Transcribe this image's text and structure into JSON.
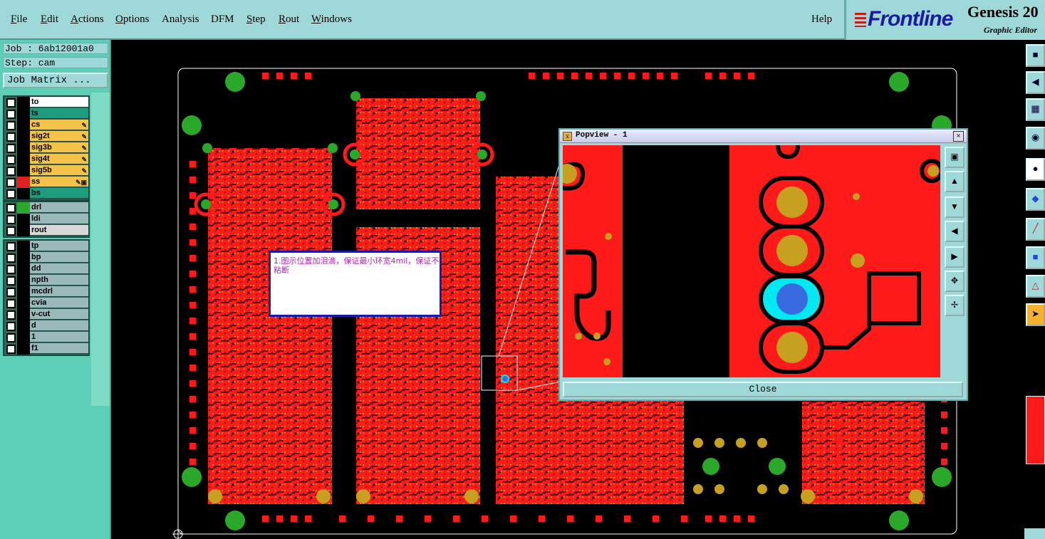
{
  "menu": {
    "file": {
      "u": "F",
      "rest": "ile"
    },
    "edit": {
      "u": "E",
      "rest": "dit"
    },
    "actions": {
      "u": "A",
      "rest": "ctions"
    },
    "options": {
      "u": "O",
      "rest": "ptions"
    },
    "analysis": {
      "u": "",
      "rest": "Analysis"
    },
    "dfm": {
      "u": "",
      "rest": "DFM"
    },
    "step": {
      "u": "S",
      "rest": "tep"
    },
    "rout": {
      "u": "R",
      "rest": "out"
    },
    "windows": {
      "u": "W",
      "rest": "indows"
    },
    "help": {
      "u": "",
      "rest": "Help"
    }
  },
  "brand": {
    "logo_text": "Frontline",
    "product": "Genesis 20",
    "subtitle": "Graphic Editor"
  },
  "job": {
    "job_line": "Job : 6ab12001a0",
    "step_line": "Step: cam",
    "matrix_button": "Job Matrix ..."
  },
  "layers_group1": [
    {
      "name": "to",
      "color": "#ffffff",
      "mid": "#000000",
      "flag": ""
    },
    {
      "name": "ts",
      "color": "#1d9c7e",
      "mid": "#000000",
      "flag": ""
    },
    {
      "name": "cs",
      "color": "#f5c24a",
      "mid": "#000000",
      "flag": "✎"
    },
    {
      "name": "sig2t",
      "color": "#f5c24a",
      "mid": "#000000",
      "flag": "✎"
    },
    {
      "name": "sig3b",
      "color": "#f5c24a",
      "mid": "#000000",
      "flag": "✎"
    },
    {
      "name": "sig4t",
      "color": "#f5c24a",
      "mid": "#000000",
      "flag": "✎"
    },
    {
      "name": "sig5b",
      "color": "#f5c24a",
      "mid": "#000000",
      "flag": "✎"
    },
    {
      "name": "ss",
      "color": "#f5c24a",
      "mid": "#e02020",
      "flag": "✎▣"
    },
    {
      "name": "bs",
      "color": "#1d9c7e",
      "mid": "#000000",
      "flag": ""
    }
  ],
  "layers_group2": [
    {
      "name": "drl",
      "color": "#9bb8bb",
      "mid": "#2aa82a",
      "flag": ""
    },
    {
      "name": "ldi",
      "color": "#9bb8bb",
      "mid": "#000000",
      "flag": ""
    },
    {
      "name": "rout",
      "color": "#d8d8d8",
      "mid": "#000000",
      "flag": ""
    }
  ],
  "layers_group3": [
    {
      "name": "tp",
      "color": "#9bb8bb",
      "mid": "#000000",
      "flag": ""
    },
    {
      "name": "bp",
      "color": "#9bb8bb",
      "mid": "#000000",
      "flag": ""
    },
    {
      "name": "dd",
      "color": "#9bb8bb",
      "mid": "#000000",
      "flag": ""
    },
    {
      "name": "npth",
      "color": "#9bb8bb",
      "mid": "#000000",
      "flag": ""
    },
    {
      "name": "mcdrl",
      "color": "#9bb8bb",
      "mid": "#000000",
      "flag": ""
    },
    {
      "name": "cvia",
      "color": "#9bb8bb",
      "mid": "#000000",
      "flag": ""
    },
    {
      "name": "v-cut",
      "color": "#9bb8bb",
      "mid": "#000000",
      "flag": ""
    },
    {
      "name": "d",
      "color": "#9bb8bb",
      "mid": "#000000",
      "flag": ""
    },
    {
      "name": "1",
      "color": "#9bb8bb",
      "mid": "#000000",
      "flag": ""
    },
    {
      "name": "f1",
      "color": "#9bb8bb",
      "mid": "#000000",
      "flag": ""
    }
  ],
  "popview": {
    "title": "Popview - 1",
    "close_label": "Close"
  },
  "note": {
    "text": "1.图示位置加泪滴，保证最小环宽4mil，保证不粘断"
  },
  "colors": {
    "copper": "#ff1a1a",
    "pad": "#c8a020",
    "fiducial": "#2aa82a",
    "selected": "#00e8f0",
    "menu_bg": "#9fd8d8",
    "panel_bg": "#5ccfb6"
  }
}
